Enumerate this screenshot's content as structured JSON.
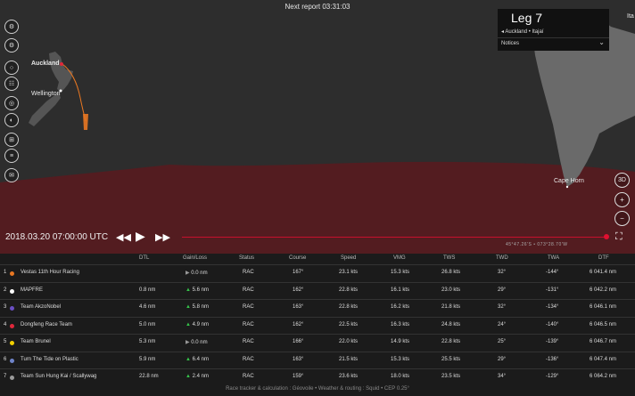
{
  "map": {
    "next_report": "Next report 03:31:03",
    "cities": {
      "auckland": "Auckland",
      "wellington": "Wellington",
      "cape_horn": "Cape Horn",
      "edge": "Ita"
    },
    "coordinates": "45°47.26'S • 073°28.70'W"
  },
  "leg": {
    "title": "Leg 7",
    "route": "Auckland • Itajaí",
    "notices": "Notices"
  },
  "toolbar": [
    "⚙",
    "⚙",
    "○",
    "☷",
    "◎",
    "◐",
    "⊞",
    "≡",
    "✉"
  ],
  "controls": {
    "three_d": "3D",
    "zoom_in": "+",
    "zoom_out": "−"
  },
  "playback": {
    "date": "2018.03.20 07:00:00 UTC"
  },
  "table": {
    "headers": {
      "dtl": "DTL",
      "gain": "Gain/Loss",
      "status": "Status",
      "course": "Course",
      "speed": "Speed",
      "vmg": "VMG",
      "tws": "TWS",
      "twd": "TWD",
      "twa": "TWA",
      "dtf": "DTF"
    },
    "rows": [
      {
        "rank": "1",
        "team": "Vestas 11th Hour Racing",
        "color": "#e87722",
        "dtl": "",
        "gain": "0.0 nm",
        "dir": "right",
        "status": "RAC",
        "course": "167°",
        "speed": "23.1 kts",
        "vmg": "15.3 kts",
        "tws": "26.8 kts",
        "twd": "32°",
        "twa": "-144°",
        "dtf": "6 041.4 nm"
      },
      {
        "rank": "2",
        "team": "MAPFRE",
        "color": "#ffffff",
        "dtl": "0.8 nm",
        "gain": "5.6 nm",
        "dir": "up",
        "status": "RAC",
        "course": "162°",
        "speed": "22.8 kts",
        "vmg": "16.1 kts",
        "tws": "23.0 kts",
        "twd": "29°",
        "twa": "-131°",
        "dtf": "6 042.2 nm"
      },
      {
        "rank": "3",
        "team": "Team AkzoNobel",
        "color": "#6a4fc3",
        "dtl": "4.6 nm",
        "gain": "5.8 nm",
        "dir": "up",
        "status": "RAC",
        "course": "163°",
        "speed": "22.8 kts",
        "vmg": "16.2 kts",
        "tws": "21.8 kts",
        "twd": "32°",
        "twa": "-134°",
        "dtf": "6 046.1 nm"
      },
      {
        "rank": "4",
        "team": "Dongfeng Race Team",
        "color": "#e0283b",
        "dtl": "5.0 nm",
        "gain": "4.9 nm",
        "dir": "up",
        "status": "RAC",
        "course": "162°",
        "speed": "22.5 kts",
        "vmg": "16.3 kts",
        "tws": "24.8 kts",
        "twd": "24°",
        "twa": "-140°",
        "dtf": "6 046.5 nm"
      },
      {
        "rank": "5",
        "team": "Team Brunel",
        "color": "#f2d000",
        "dtl": "5.3 nm",
        "gain": "0.0 nm",
        "dir": "right",
        "status": "RAC",
        "course": "166°",
        "speed": "22.0 kts",
        "vmg": "14.9 kts",
        "tws": "22.8 kts",
        "twd": "25°",
        "twa": "-139°",
        "dtf": "6 046.7 nm"
      },
      {
        "rank": "6",
        "team": "Turn The Tide on Plastic",
        "color": "#6f84c9",
        "dtl": "5.9 nm",
        "gain": "6.4 nm",
        "dir": "up",
        "status": "RAC",
        "course": "163°",
        "speed": "21.5 kts",
        "vmg": "15.3 kts",
        "tws": "25.5 kts",
        "twd": "29°",
        "twa": "-136°",
        "dtf": "6 047.4 nm"
      },
      {
        "rank": "7",
        "team": "Team Sun Hung Kai / Scallywag",
        "color": "#9a9a9a",
        "dtl": "22.8 nm",
        "gain": "2.4 nm",
        "dir": "up",
        "status": "RAC",
        "course": "159°",
        "speed": "23.6 kts",
        "vmg": "18.0 kts",
        "tws": "23.5 kts",
        "twd": "34°",
        "twa": "-129°",
        "dtf": "6 064.2 nm"
      }
    ]
  },
  "footer": "Race tracker & calculation : Géovoile • Weather & routing : Squid • CEP 0.25°"
}
